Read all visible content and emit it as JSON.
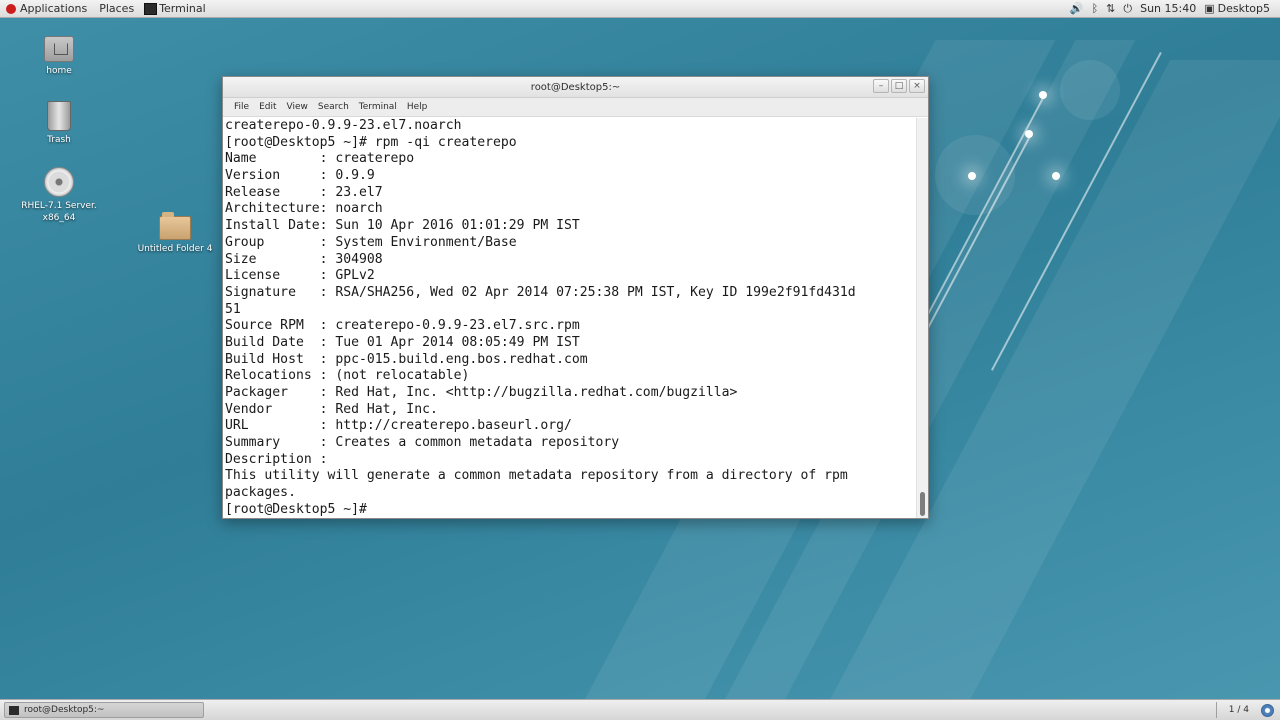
{
  "top_panel": {
    "applications": "Applications",
    "places": "Places",
    "terminal_task": "Terminal",
    "tray_icons": [
      "volume-icon",
      "bluetooth-icon",
      "network-icon",
      "power-icon"
    ],
    "clock": "Sun 15:40",
    "user": "Desktop5"
  },
  "desktop": {
    "icons": [
      {
        "label": "home",
        "icon": "home-folder-icon"
      },
      {
        "label": "Trash",
        "icon": "trash-icon"
      },
      {
        "label": "RHEL-7.1 Server. x86_64",
        "icon": "dvd-icon"
      },
      {
        "label": "Untitled Folder 4",
        "icon": "folder-icon"
      }
    ]
  },
  "terminal": {
    "title": "root@Desktop5:~",
    "menu": [
      "File",
      "Edit",
      "View",
      "Search",
      "Terminal",
      "Help"
    ],
    "window_buttons": [
      "minimize-icon",
      "maximize-icon",
      "close-icon"
    ],
    "lines": [
      "createrepo-0.9.9-23.el7.noarch",
      "[root@Desktop5 ~]# rpm -qi createrepo",
      "Name        : createrepo",
      "Version     : 0.9.9",
      "Release     : 23.el7",
      "Architecture: noarch",
      "Install Date: Sun 10 Apr 2016 01:01:29 PM IST",
      "Group       : System Environment/Base",
      "Size        : 304908",
      "License     : GPLv2",
      "Signature   : RSA/SHA256, Wed 02 Apr 2014 07:25:38 PM IST, Key ID 199e2f91fd431d",
      "51",
      "Source RPM  : createrepo-0.9.9-23.el7.src.rpm",
      "Build Date  : Tue 01 Apr 2014 08:05:49 PM IST",
      "Build Host  : ppc-015.build.eng.bos.redhat.com",
      "Relocations : (not relocatable)",
      "Packager    : Red Hat, Inc. <http://bugzilla.redhat.com/bugzilla>",
      "Vendor      : Red Hat, Inc.",
      "URL         : http://createrepo.baseurl.org/",
      "Summary     : Creates a common metadata repository",
      "Description :",
      "This utility will generate a common metadata repository from a directory of rpm",
      "packages.",
      "[root@Desktop5 ~]# "
    ]
  },
  "bottom_panel": {
    "task_label": "root@Desktop5:~",
    "workspace": "1 / 4"
  }
}
